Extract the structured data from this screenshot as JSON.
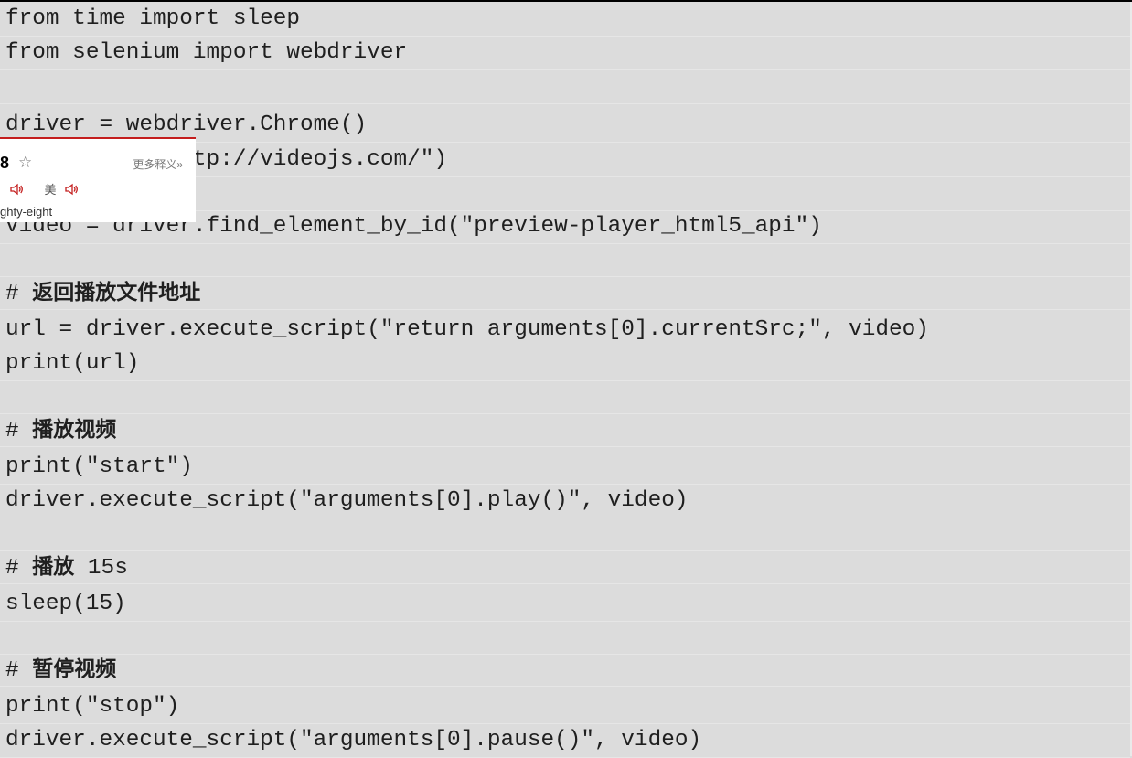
{
  "code_lines": [
    "from time import sleep",
    "from selenium import webdriver",
    "",
    "driver = webdriver.Chrome()",
    "driver.get(\"http://videojs.com/\")",
    "",
    "video = driver.find_element_by_id(\"preview-player_html5_api\")",
    "",
    "# 返回播放文件地址",
    "url = driver.execute_script(\"return arguments[0].currentSrc;\", video)",
    "print(url)",
    "",
    "# 播放视频",
    "print(\"start\")",
    "driver.execute_script(\"arguments[0].play()\", video)",
    "",
    "# 播放 15s",
    "sleep(15)",
    "",
    "# 暂停视频",
    "print(\"stop\")",
    "driver.execute_script(\"arguments[0].pause()\", video)"
  ],
  "popup": {
    "word": "8",
    "star": "☆",
    "more_label": "更多释义»",
    "us_label": "美",
    "definition": "ghty-eight"
  },
  "colors": {
    "accent": "#c41e1e",
    "background": "#dcdcdc"
  }
}
